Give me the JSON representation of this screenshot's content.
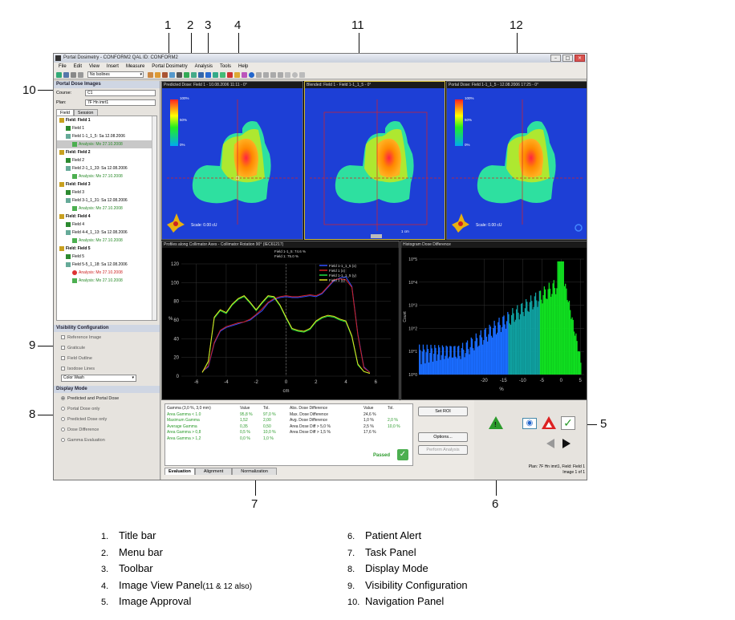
{
  "callouts": [
    "1",
    "2",
    "3",
    "4",
    "11",
    "12",
    "10",
    "9",
    "8",
    "7",
    "6",
    "5"
  ],
  "window": {
    "title": "Portal Dosimetry - CONFORM2 QAL ID: CONFORM2",
    "menu": [
      "File",
      "Edit",
      "View",
      "Insert",
      "Measure",
      "Portal Dosimetry",
      "Analysis",
      "Tools",
      "Help"
    ],
    "toolbar_select": "No Isolines"
  },
  "nav": {
    "header": "Portal Dose Images",
    "course_label": "Course:",
    "course_value": "C1",
    "plan_label": "Plan:",
    "plan_value": "7F Hn imrt1",
    "tabs": [
      "Field",
      "Session"
    ],
    "tree": [
      {
        "label": "Field: Field 1",
        "level": 0,
        "icon": "f"
      },
      {
        "label": "Field 1",
        "level": 1,
        "icon": "g"
      },
      {
        "label": "Field 1-1_1_5: Sa 12.08.2006",
        "level": 1,
        "icon": "d"
      },
      {
        "label": "Analysis: Mo 27.10.2008",
        "level": 2,
        "icon": "a"
      },
      {
        "label": "Field: Field 2",
        "level": 0,
        "icon": "f"
      },
      {
        "label": "Field 2",
        "level": 1,
        "icon": "g"
      },
      {
        "label": "Field 2-1_1_33: Sa 12.08.2006",
        "level": 1,
        "icon": "d"
      },
      {
        "label": "Analysis: Mo 27.10.2008",
        "level": 2,
        "icon": "a"
      },
      {
        "label": "Field: Field 3",
        "level": 0,
        "icon": "f"
      },
      {
        "label": "Field 3",
        "level": 1,
        "icon": "g"
      },
      {
        "label": "Field 3-1_1_31: Sa 12.08.2006",
        "level": 1,
        "icon": "d"
      },
      {
        "label": "Analysis: Mo 27.10.2008",
        "level": 2,
        "icon": "a"
      },
      {
        "label": "Field: Field 4",
        "level": 0,
        "icon": "f"
      },
      {
        "label": "Field 4",
        "level": 1,
        "icon": "g"
      },
      {
        "label": "Field 4-4_1_13: Sa 12.08.2006",
        "level": 1,
        "icon": "d"
      },
      {
        "label": "Analysis: Mo 27.10.2008",
        "level": 2,
        "icon": "a"
      },
      {
        "label": "Field: Field 5",
        "level": 0,
        "icon": "f"
      },
      {
        "label": "Field 5",
        "level": 1,
        "icon": "g"
      },
      {
        "label": "Field 5-5_1_18: Sa 12.08.2006",
        "level": 1,
        "icon": "d"
      },
      {
        "label": "Analysis: Mo 27.10.2008",
        "level": 2,
        "icon": "r"
      },
      {
        "label": "Analysis: Mo 27.10.2008",
        "level": 2,
        "icon": "a"
      }
    ],
    "visibility_header": "Visibility Configuration",
    "visibility_options": [
      "Reference Image",
      "Graticule",
      "Field Outline",
      "Isodose Lines"
    ],
    "color_wash": "Color Wash",
    "display_header": "Display Mode",
    "display_options": [
      "Predicted and Portal Dose",
      "Portal Dose only",
      "Predicted Dose only",
      "Dose Difference",
      "Gamma Evaluation"
    ]
  },
  "views": {
    "predicted_title": "Predicted Dose: Field 1 - 10.08.2006 11:11 - 0°",
    "blended_title": "Blended: Field 1 - Field 1-1_1_5 - 0°",
    "portal_title": "Portal Dose: Field 1-1_1_5 - 12.08.2006 17:25 - 0°",
    "scale_labels": [
      "100%",
      "50%",
      "0%"
    ],
    "image_info": "Scale: 0.00 cU",
    "blended_info": "1 cm",
    "profile_title": "Profiles along Collimator Axes - Collimator Rotation 90° (IEC61217)",
    "profile_subtitle": [
      "Field 1-1_5: 74.6 %",
      "Field 1: 75.0 %"
    ],
    "histo_title": "Histogram Dose Difference",
    "profile_legend": [
      "Field 1-1_1_5 (x)",
      "Field 1 (x)",
      "Field 1-1_1_5 (y)",
      "Field 1 (y)"
    ]
  },
  "chart_data": [
    {
      "type": "line",
      "title": "Profiles along Collimator Axes - Collimator Rotation 90° (IEC61217)",
      "xlabel": "cm",
      "ylabel": "%",
      "xlim": [
        -7,
        7
      ],
      "ylim": [
        0,
        120
      ],
      "xticks": [
        "-6",
        "-4",
        "-2",
        "0",
        "2",
        "4",
        "6"
      ],
      "yticks": [
        "0",
        "20",
        "40",
        "60",
        "80",
        "100",
        "120"
      ],
      "series": [
        {
          "name": "Field 1-1_1_5 (x)",
          "color": "#3050ff",
          "x": [
            -5.6,
            -5.2,
            -4.8,
            -4.4,
            -4.0,
            -3.6,
            -3.2,
            -2.8,
            -2.4,
            -2.0,
            -1.6,
            -1.2,
            -0.8,
            -0.4,
            0,
            0.4,
            0.8,
            1.2,
            1.6,
            2.0,
            2.4,
            2.8,
            3.2,
            3.6,
            4.0,
            4.4,
            4.8,
            5.2,
            5.6
          ],
          "y": [
            5,
            10,
            35,
            48,
            52,
            54,
            56,
            58,
            60,
            65,
            70,
            78,
            82,
            84,
            85,
            84,
            84,
            85,
            86,
            85,
            88,
            95,
            102,
            105,
            106,
            96,
            45,
            10,
            4
          ]
        },
        {
          "name": "Field 1 (x)",
          "color": "#d02020",
          "x": [
            -5.6,
            -5.2,
            -4.8,
            -4.4,
            -4.0,
            -3.6,
            -3.2,
            -2.8,
            -2.4,
            -2.0,
            -1.6,
            -1.2,
            -0.8,
            -0.4,
            0,
            0.4,
            0.8,
            1.2,
            1.6,
            2.0,
            2.4,
            2.8,
            3.2,
            3.6,
            4.0,
            4.4,
            4.8,
            5.2,
            5.6
          ],
          "y": [
            5,
            11,
            36,
            49,
            53,
            55,
            57,
            58,
            61,
            66,
            72,
            79,
            83,
            85,
            86,
            85,
            85,
            86,
            87,
            86,
            89,
            96,
            103,
            104,
            103,
            95,
            44,
            9,
            4
          ]
        },
        {
          "name": "Field 1-1_1_5 (y)",
          "color": "#20e040",
          "x": [
            -5.6,
            -5.2,
            -4.8,
            -4.4,
            -4.0,
            -3.6,
            -3.2,
            -2.8,
            -2.4,
            -2.0,
            -1.6,
            -1.2,
            -0.8,
            -0.4,
            0,
            0.4,
            0.8,
            1.2,
            1.6,
            2.0,
            2.4,
            2.8,
            3.2,
            3.6,
            4.0,
            4.4,
            4.8,
            5.2,
            5.6
          ],
          "y": [
            4,
            15,
            62,
            70,
            67,
            76,
            82,
            85,
            78,
            70,
            78,
            85,
            84,
            75,
            62,
            50,
            48,
            47,
            50,
            58,
            62,
            64,
            63,
            60,
            58,
            42,
            12,
            5,
            3
          ]
        },
        {
          "name": "Field 1 (y)",
          "color": "#e0e020",
          "x": [
            -5.6,
            -5.2,
            -4.8,
            -4.4,
            -4.0,
            -3.6,
            -3.2,
            -2.8,
            -2.4,
            -2.0,
            -1.6,
            -1.2,
            -0.8,
            -0.4,
            0,
            0.4,
            0.8,
            1.2,
            1.6,
            2.0,
            2.4,
            2.8,
            3.2,
            3.6,
            4.0,
            4.4,
            4.8,
            5.2,
            5.6
          ],
          "y": [
            4,
            16,
            63,
            71,
            68,
            77,
            83,
            86,
            79,
            71,
            79,
            86,
            85,
            76,
            63,
            51,
            49,
            48,
            51,
            59,
            63,
            65,
            64,
            61,
            59,
            43,
            13,
            5,
            3
          ]
        }
      ]
    },
    {
      "type": "bar",
      "title": "Histogram Dose Difference",
      "xlabel": "%",
      "ylabel": "Count",
      "xlim": [
        -37,
        6
      ],
      "xticks": [
        "-20",
        "-15",
        "-10",
        "-5",
        "0",
        "5"
      ],
      "yticks": [
        "10^0",
        "10^1",
        "10^2",
        "10^3",
        "10^4",
        "10^5"
      ],
      "log_y": true
    }
  ],
  "task": {
    "gamma_header": "Gamma (3,0 %, 3,0 mm)",
    "value_header": "Value",
    "tol_header": "Tol.",
    "gamma_rows": [
      {
        "label": "Area Gamma < 1.0",
        "value": "95,8 %",
        "tol": "97,0 %"
      },
      {
        "label": "Maximum Gamma",
        "value": "1,52",
        "tol": "2,00"
      },
      {
        "label": "Average Gamma",
        "value": "0,35",
        "tol": "0,50"
      },
      {
        "label": "Area Gamma > 0,8",
        "value": "0,5 %",
        "tol": "10,0 %"
      },
      {
        "label": "Area Gamma > 1,2",
        "value": "0,0 %",
        "tol": "1,0 %"
      }
    ],
    "abs_header": "Abs. Dose Difference",
    "abs_rows": [
      {
        "label": "Max. Dose Difference",
        "value": "24,6 %",
        "tol": ""
      },
      {
        "label": "Avg. Dose Difference",
        "value": "1,0 %",
        "tol": "2,0 %"
      },
      {
        "label": "Area Dose Diff > 5,0 %",
        "value": "2,5 %",
        "tol": "10,0 %"
      },
      {
        "label": "Area Dose Diff > 1,5 %",
        "value": "17,6 %",
        "tol": ""
      }
    ],
    "passed": "Passed",
    "set_roi": "Set ROI",
    "options": "Options...",
    "perform": "Perform Analysis",
    "tabs": [
      "Evaluation",
      "Alignment",
      "Normalization"
    ]
  },
  "approval": {
    "status": "Plan: 7F Hn imrt1, Field: Field 1",
    "image_count": "Image 1 of 1"
  },
  "legend": [
    {
      "num": "1.",
      "label": "Title bar"
    },
    {
      "num": "2.",
      "label": "Menu bar"
    },
    {
      "num": "3.",
      "label": "Toolbar"
    },
    {
      "num": "4.",
      "label": "Image View Panel",
      "note": "(11 & 12 also)"
    },
    {
      "num": "5.",
      "label": "Image Approval"
    },
    {
      "num": "6.",
      "label": "Patient Alert"
    },
    {
      "num": "7.",
      "label": "Task Panel"
    },
    {
      "num": "8.",
      "label": "Display Mode"
    },
    {
      "num": "9.",
      "label": "Visibility Configuration"
    },
    {
      "num": "10.",
      "label": "Navigation Panel"
    }
  ]
}
